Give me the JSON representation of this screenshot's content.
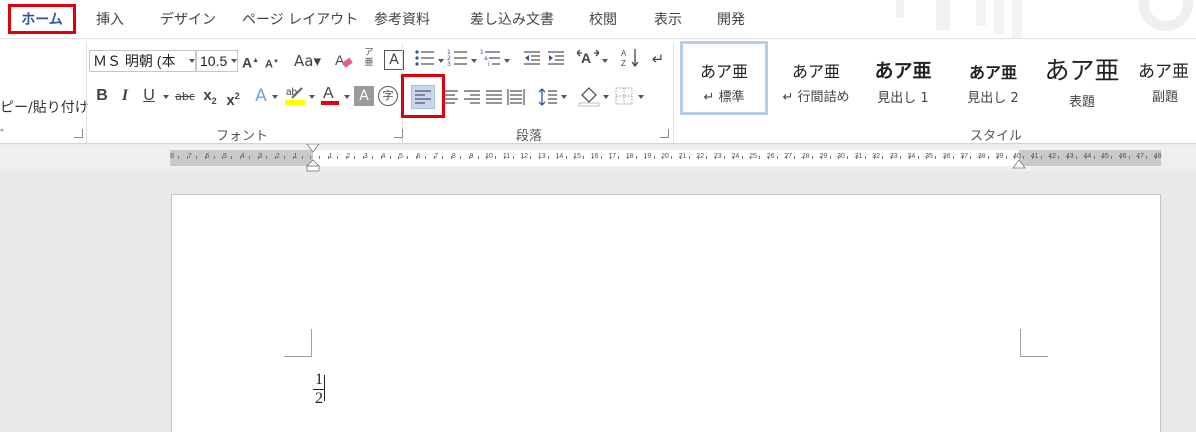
{
  "tabs": {
    "home": "ホーム",
    "insert": "挿入",
    "design": "デザイン",
    "layout": "ページ レイアウト",
    "references": "参考資料",
    "mailings": "差し込み文書",
    "review": "校閲",
    "view": "表示",
    "developer": "開発"
  },
  "clipboard": {
    "paste_label": "ピー/貼り付け",
    "group_label": "ﾞ"
  },
  "font": {
    "family": "ＭＳ 明朝 (本",
    "size": "10.5",
    "group_label": "フォント"
  },
  "paragraph": {
    "group_label": "段落"
  },
  "styles": {
    "group_label": "スタイル",
    "items": [
      {
        "sample": "あア亜",
        "name": "↵ 標準"
      },
      {
        "sample": "あア亜",
        "name": "↵ 行間詰め"
      },
      {
        "sample": "あア亜",
        "name": "見出し 1"
      },
      {
        "sample": "あア亜",
        "name": "見出し 2"
      },
      {
        "sample": "あア亜",
        "name": "表題"
      },
      {
        "sample": "あア亜",
        "name": "副題"
      }
    ]
  },
  "ruler": {
    "left_numbers": [
      "8",
      "7",
      "6",
      "5",
      "4",
      "3",
      "2",
      "1"
    ],
    "right_numbers": [
      "1",
      "2",
      "3",
      "4",
      "5",
      "6",
      "7",
      "8",
      "9",
      "10",
      "11",
      "12",
      "13",
      "14",
      "15",
      "16",
      "17",
      "18",
      "19",
      "20",
      "21",
      "22",
      "23",
      "24",
      "25",
      "26",
      "27",
      "28",
      "29",
      "30",
      "31",
      "32",
      "33",
      "34",
      "35",
      "36",
      "37",
      "38",
      "39",
      "40",
      "41",
      "42",
      "43",
      "44",
      "45",
      "46",
      "47",
      "48"
    ]
  },
  "document": {
    "numerator": "1",
    "denominator": "2"
  },
  "colors": {
    "highlight_red": "#e0000f",
    "accent_blue": "#2b579a",
    "selected_style_border": "#b8cde8",
    "font_color_red": "#e0000f",
    "highlighter_yellow": "#ffff00"
  }
}
